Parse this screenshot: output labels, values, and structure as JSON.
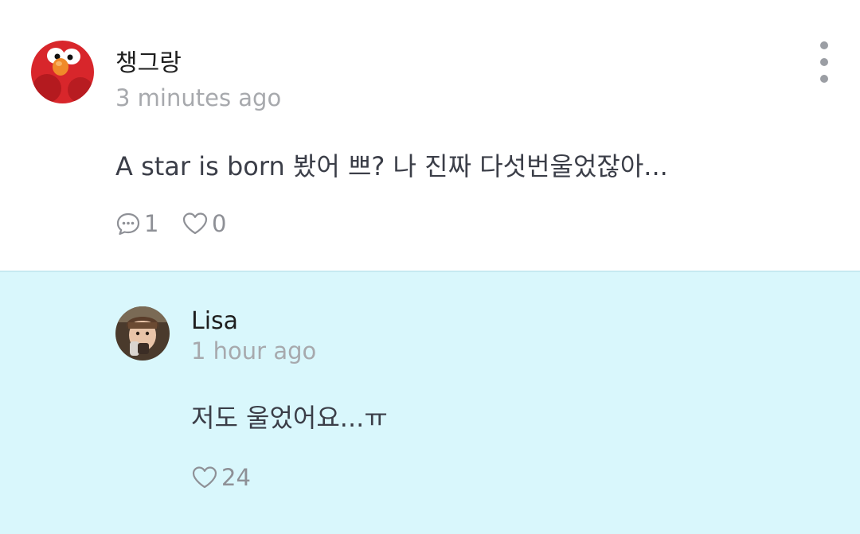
{
  "main_comment": {
    "username": "챙그랑",
    "timestamp": "3 minutes ago",
    "text": "A star is born 봤어 쁘? 나 진짜 다섯번울었잖아...",
    "reply_count": "1",
    "like_count": "0",
    "avatar_icon": "elmo-avatar",
    "more_icon": "more-vertical-icon"
  },
  "reply": {
    "username": "Lisa",
    "timestamp": "1 hour ago",
    "text": "저도 울었어요...ㅠ",
    "like_count": "24",
    "avatar_icon": "user-photo-avatar"
  },
  "colors": {
    "reply_background": "#d9f7fc",
    "divider": "#c7eaf1",
    "text_primary": "#1e1e1e",
    "text_body": "#3b3e48",
    "text_muted": "#a7a9ad",
    "icon_gray": "#8e9096"
  }
}
